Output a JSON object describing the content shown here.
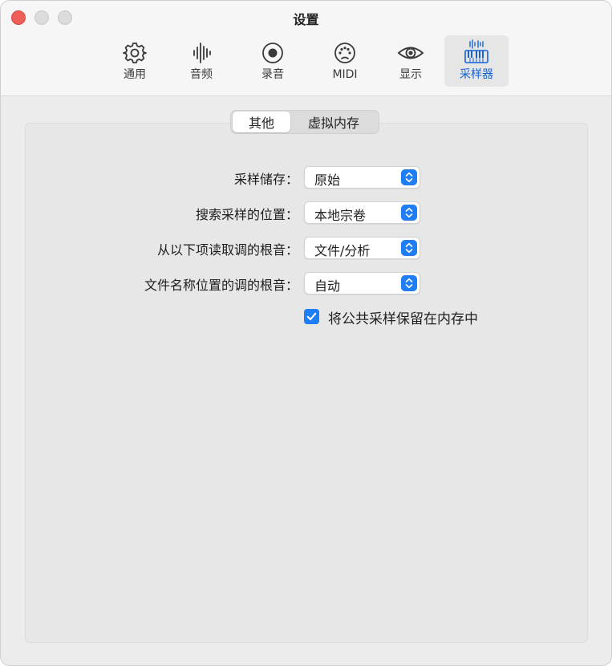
{
  "window": {
    "title": "设置"
  },
  "toolbar": {
    "items": [
      {
        "label": "通用",
        "icon": "gear-icon"
      },
      {
        "label": "音频",
        "icon": "waveform-icon"
      },
      {
        "label": "录音",
        "icon": "record-icon"
      },
      {
        "label": "MIDI",
        "icon": "midi-port-icon"
      },
      {
        "label": "显示",
        "icon": "eye-icon"
      },
      {
        "label": "采样器",
        "icon": "sampler-keyboard-icon"
      }
    ],
    "selected": "采样器"
  },
  "tabs": {
    "items": [
      "其他",
      "虚拟内存"
    ],
    "selected": "其他"
  },
  "settings": {
    "sample_storage": {
      "label": "采样储存：",
      "value": "原始"
    },
    "search_location": {
      "label": "搜索采样的位置：",
      "value": "本地宗卷"
    },
    "root_key_source": {
      "label": "从以下项读取调的根音：",
      "value": "文件/分析"
    },
    "filename_root_key_position": {
      "label": "文件名称位置的调的根音：",
      "value": "自动"
    }
  },
  "checkbox": {
    "label": "将公共采样保留在内存中",
    "checked": true
  },
  "colors": {
    "accent": "#1f7df5",
    "close": "#ee5f58",
    "selected_tab_text": "#1463d6"
  }
}
